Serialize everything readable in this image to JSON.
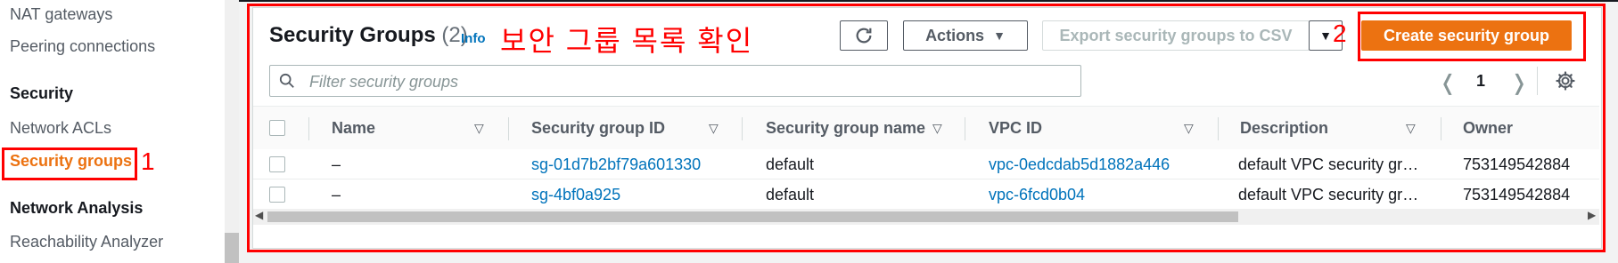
{
  "sidebar": {
    "nat_gateways": "NAT gateways",
    "peering": "Peering connections",
    "security_head": "Security",
    "network_acls": "Network ACLs",
    "security_groups": "Security groups",
    "network_analysis_head": "Network Analysis",
    "reachability": "Reachability Analyzer"
  },
  "header": {
    "title": "Security Groups",
    "count": "(2)",
    "info": "Info",
    "annotation_korean": "보안 그룹 목록 확인",
    "actions_label": "Actions",
    "export_label": "Export security groups to CSV",
    "create_label": "Create security group"
  },
  "search": {
    "placeholder": "Filter security groups"
  },
  "pagination": {
    "page": "1"
  },
  "table": {
    "columns": [
      "Name",
      "Security group ID",
      "Security group name",
      "VPC ID",
      "Description",
      "Owner"
    ],
    "rows": [
      {
        "name": "–",
        "sg_id": "sg-01d7b2bf79a601330",
        "sg_name": "default",
        "vpc_id": "vpc-0edcdab5d1882a446",
        "description": "default VPC security gr…",
        "owner": "753149542884"
      },
      {
        "name": "–",
        "sg_id": "sg-4bf0a925",
        "sg_name": "default",
        "vpc_id": "vpc-6fcd0b04",
        "description": "default VPC security gr…",
        "owner": "753149542884"
      }
    ]
  },
  "annotations": {
    "marker_1": "1",
    "marker_2": "2"
  },
  "colors": {
    "accent": "#ec7211",
    "link": "#0073bb",
    "annotation": "#ff0000"
  }
}
